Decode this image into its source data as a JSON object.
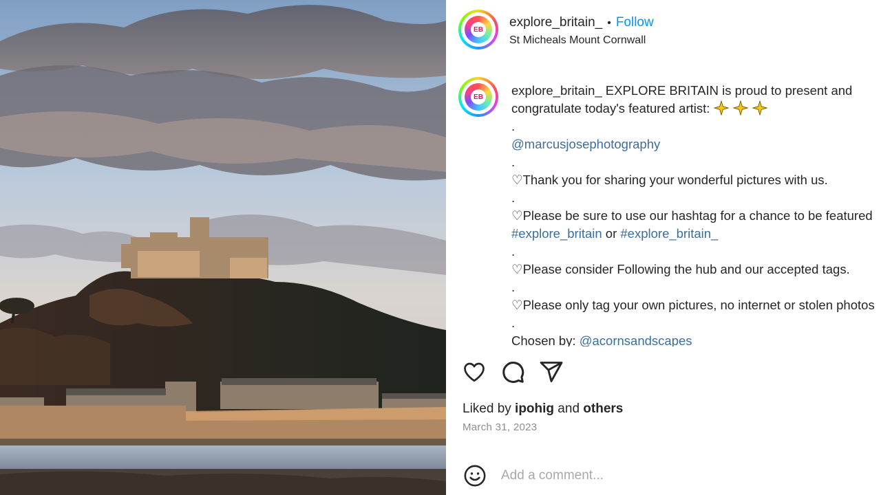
{
  "post": {
    "photo_alt": "St Michaels Mount castle on a hill at sunset",
    "header": {
      "avatar_initials": "EB",
      "username": "explore_britain_",
      "separator": "•",
      "follow_label": "Follow",
      "location": "St Micheals Mount Cornwall"
    },
    "caption": {
      "avatar_initials": "EB",
      "username": "explore_britain_",
      "lines": {
        "l1": " EXPLORE BRITAIN is proud to present and",
        "l2": "congratulate today's featured artist: ",
        "d1": ".",
        "mention_artist": "@marcusjosephotography",
        "d2": ".",
        "thanks": "♡Thank you for sharing your wonderful pictures with us.",
        "d3": ".",
        "hashtag_note": "♡Please be sure to use our hashtag for a chance to be featured",
        "tag1": "#explore_britain",
        "or": " or ",
        "tag2": "#explore_britain_",
        "d4": ".",
        "follow_note": "♡Please consider Following the hub and our accepted tags.",
        "d5": ".",
        "own_note": "♡Please only tag your own pictures, no internet or stolen photos",
        "d6": ".",
        "chosen_by": "Chosen by: ",
        "chooser": "@acornsandscapes"
      }
    },
    "actions": {
      "like_icon": "heart-icon",
      "comment_icon": "comment-icon",
      "share_icon": "send-icon"
    },
    "likes": {
      "prefix": "Liked by ",
      "user": "ipohig",
      "middle": " and ",
      "others": "others"
    },
    "date": "March 31, 2023",
    "comment": {
      "emoji_icon": "smiley-icon",
      "placeholder": "Add a comment..."
    },
    "colors": {
      "follow": "#0095f6",
      "link": "#3b6e9b",
      "muted": "#8e8e8e"
    }
  }
}
